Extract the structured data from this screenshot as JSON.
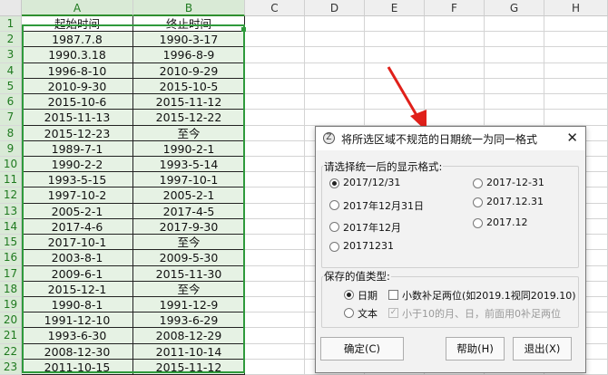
{
  "sheet": {
    "columns": [
      "A",
      "B",
      "C",
      "D",
      "E",
      "F",
      "G",
      "H"
    ],
    "rows": [
      "1",
      "2",
      "3",
      "4",
      "5",
      "6",
      "7",
      "8",
      "9",
      "10",
      "11",
      "12",
      "13",
      "14",
      "15",
      "16",
      "17",
      "18",
      "19",
      "20",
      "21",
      "22",
      "23"
    ],
    "cells": [
      [
        "起始时间",
        "终止时间"
      ],
      [
        "1987.7.8",
        "1990-3-17"
      ],
      [
        "1990.3.18",
        "1996-8-9"
      ],
      [
        "1996-8-10",
        "2010-9-29"
      ],
      [
        "2010-9-30",
        "2015-10-5"
      ],
      [
        "2015-10-6",
        "2015-11-12"
      ],
      [
        "2015-11-13",
        "2015-12-22"
      ],
      [
        "2015-12-23",
        "至今"
      ],
      [
        "1989-7-1",
        "1990-2-1"
      ],
      [
        "1990-2-2",
        "1993-5-14"
      ],
      [
        "1993-5-15",
        "1997-10-1"
      ],
      [
        "1997-10-2",
        "2005-2-1"
      ],
      [
        "2005-2-1",
        "2017-4-5"
      ],
      [
        "2017-4-6",
        "2017-9-30"
      ],
      [
        "2017-10-1",
        "至今"
      ],
      [
        "2003-8-1",
        "2009-5-30"
      ],
      [
        "2009-6-1",
        "2015-11-30"
      ],
      [
        "2015-12-1",
        "至今"
      ],
      [
        "1990-8-1",
        "1991-12-9"
      ],
      [
        "1991-12-10",
        "1993-6-29"
      ],
      [
        "1993-6-30",
        "2008-12-29"
      ],
      [
        "2008-12-30",
        "2011-10-14"
      ],
      [
        "2011-10-15",
        "2015-11-12"
      ]
    ]
  },
  "dialog": {
    "title": "将所选区域不规范的日期统一为同一格式",
    "format_group_label": "请选择统一后的显示格式:",
    "formats": [
      {
        "label": "2017/12/31",
        "selected": true
      },
      {
        "label": "2017-12-31",
        "selected": false
      },
      {
        "label": "2017年12月31日",
        "selected": false
      },
      {
        "label": "2017.12.31",
        "selected": false
      },
      {
        "label": "2017年12月",
        "selected": false
      },
      {
        "label": "2017.12",
        "selected": false
      },
      {
        "label": "20171231",
        "selected": false
      }
    ],
    "value_group_label": "保存的值类型:",
    "value_types": [
      {
        "label": "日期",
        "selected": true
      },
      {
        "label": "文本",
        "selected": false
      }
    ],
    "check_decimal": "小数补足两位(如2019.1视同2019.10)",
    "check_pad": "小于10的月、日，前面用0补足两位",
    "btn_ok": "确定(C)",
    "btn_help": "帮助(H)",
    "btn_exit": "退出(X)"
  },
  "colors": {
    "selection": "#2f9a3c",
    "cell_fill": "#e6f2e4",
    "arrow": "#e0201a"
  }
}
